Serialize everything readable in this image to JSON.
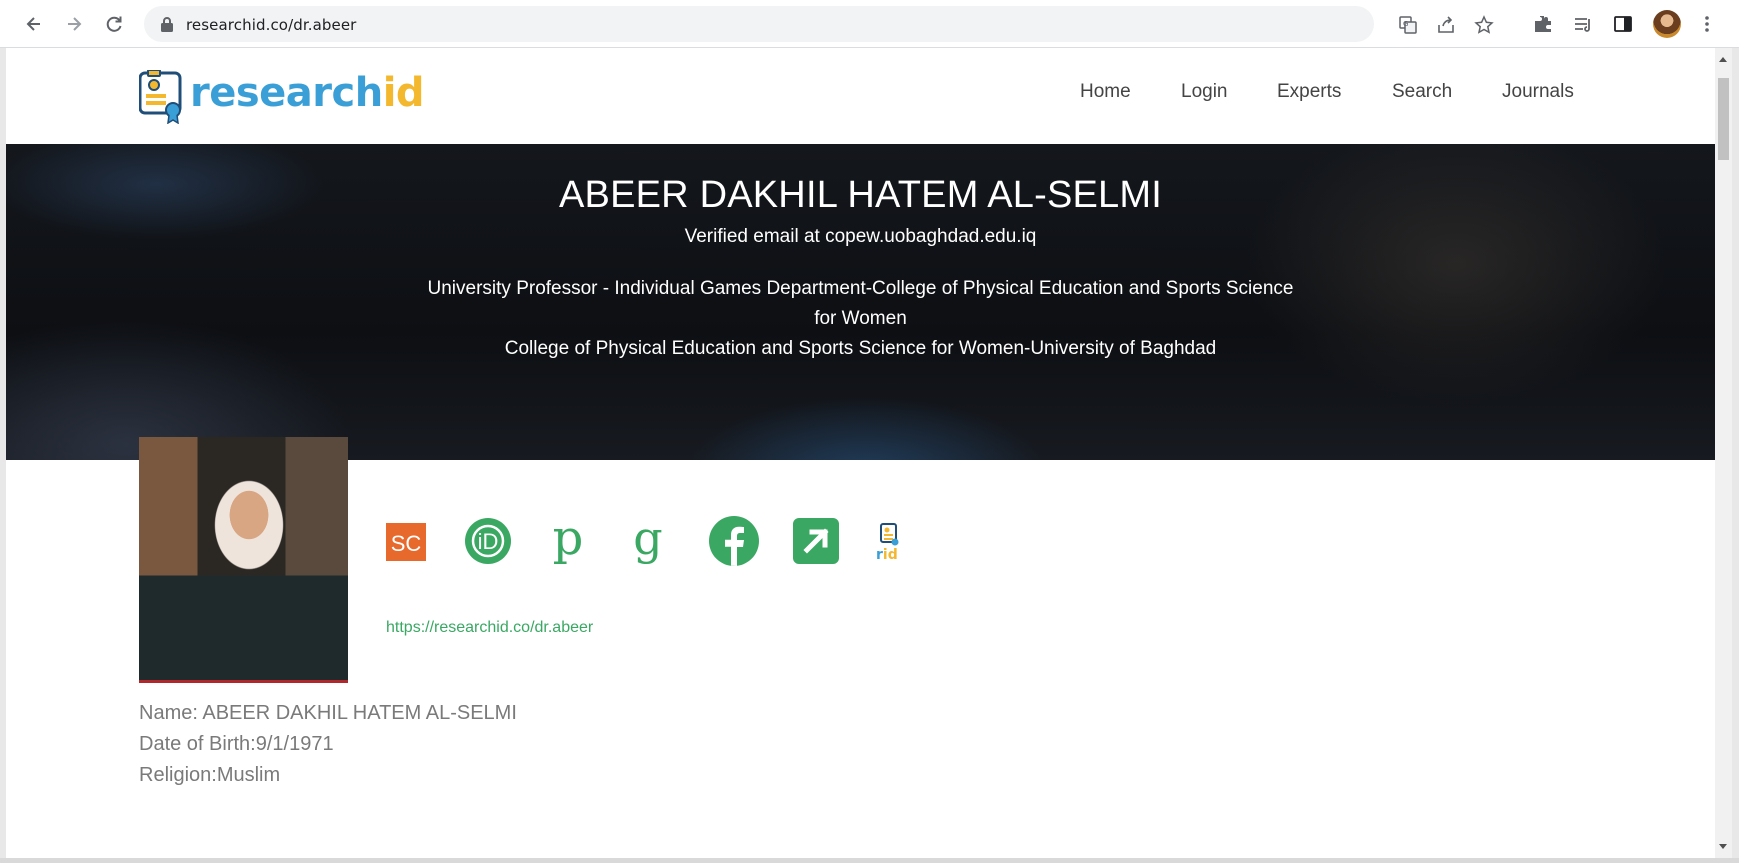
{
  "browser": {
    "url": "researchid.co/dr.abeer",
    "icons": [
      "back-icon",
      "forward-icon",
      "reload-icon",
      "lock-icon",
      "translate-icon",
      "share-icon",
      "star-icon",
      "extensions-icon",
      "reading-list-icon",
      "side-panel-icon",
      "profile-avatar",
      "menu-icon"
    ]
  },
  "site": {
    "logo": {
      "text_a": "research",
      "text_b": "id"
    },
    "nav": [
      {
        "label": "Home"
      },
      {
        "label": "Login"
      },
      {
        "label": "Experts"
      },
      {
        "label": "Search"
      },
      {
        "label": "Journals"
      }
    ]
  },
  "hero": {
    "name": "ABEER DAKHIL HATEM AL-SELMI",
    "email": "Verified email at copew.uobaghdad.edu.iq",
    "affiliation_lines": [
      "University Professor - Individual Games Department-College of Physical Education and Sports Science",
      "for Women",
      "College of Physical Education and Sports Science for Women-University of Baghdad"
    ]
  },
  "profile": {
    "social_icons": [
      {
        "name": "scopus-icon",
        "glyph": "SC"
      },
      {
        "name": "orcid-icon",
        "glyph": "iD"
      },
      {
        "name": "publons-icon",
        "glyph": "p"
      },
      {
        "name": "google-scholar-icon",
        "glyph": "g"
      },
      {
        "name": "facebook-icon",
        "glyph": "f"
      },
      {
        "name": "external-link-icon",
        "glyph": ""
      },
      {
        "name": "researchid-icon",
        "glyph": "rid"
      }
    ],
    "link": "https://researchid.co/dr.abeer",
    "details": [
      "Name: ABEER DAKHIL HATEM AL-SELMI",
      "Date of Birth:9/1/1971",
      "Religion:Muslim"
    ]
  },
  "colors": {
    "brand_blue": "#3a9fd6",
    "brand_yellow": "#f3b82e",
    "icon_green": "#3aa863",
    "scopus_orange": "#e8692c"
  }
}
